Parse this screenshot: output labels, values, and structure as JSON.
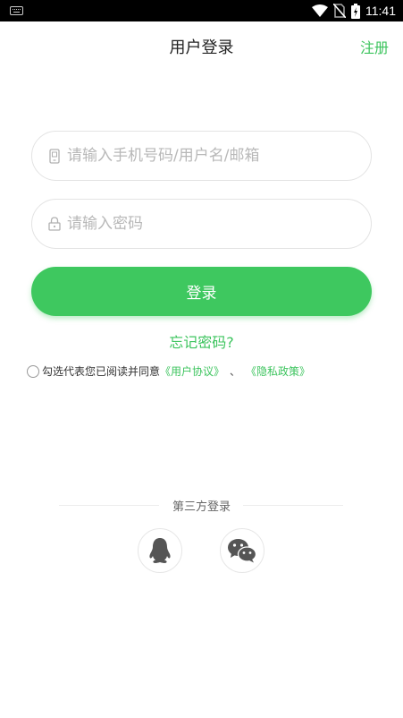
{
  "status_bar": {
    "time": "11:41",
    "icons": [
      "keyboard-icon",
      "wifi-icon",
      "no-sim-icon",
      "battery-icon"
    ]
  },
  "header": {
    "title": "用户登录",
    "register_label": "注册"
  },
  "form": {
    "account_placeholder": "请输入手机号码/用户名/邮箱",
    "account_value": "",
    "password_placeholder": "请输入密码",
    "password_value": "",
    "login_label": "登录",
    "forgot_label": "忘记密码?"
  },
  "agreement": {
    "text": "勾选代表您已阅读并同意",
    "user_agreement": "《用户协议》",
    "separator": "、",
    "privacy_policy": "《隐私政策》",
    "checked": false
  },
  "third_party": {
    "label": "第三方登录",
    "providers": [
      "qq-icon",
      "wechat-icon"
    ]
  },
  "colors": {
    "accent": "#3ec85f",
    "link": "#3dc45e",
    "placeholder": "#b8b8b8",
    "border": "#e3e3e3"
  }
}
